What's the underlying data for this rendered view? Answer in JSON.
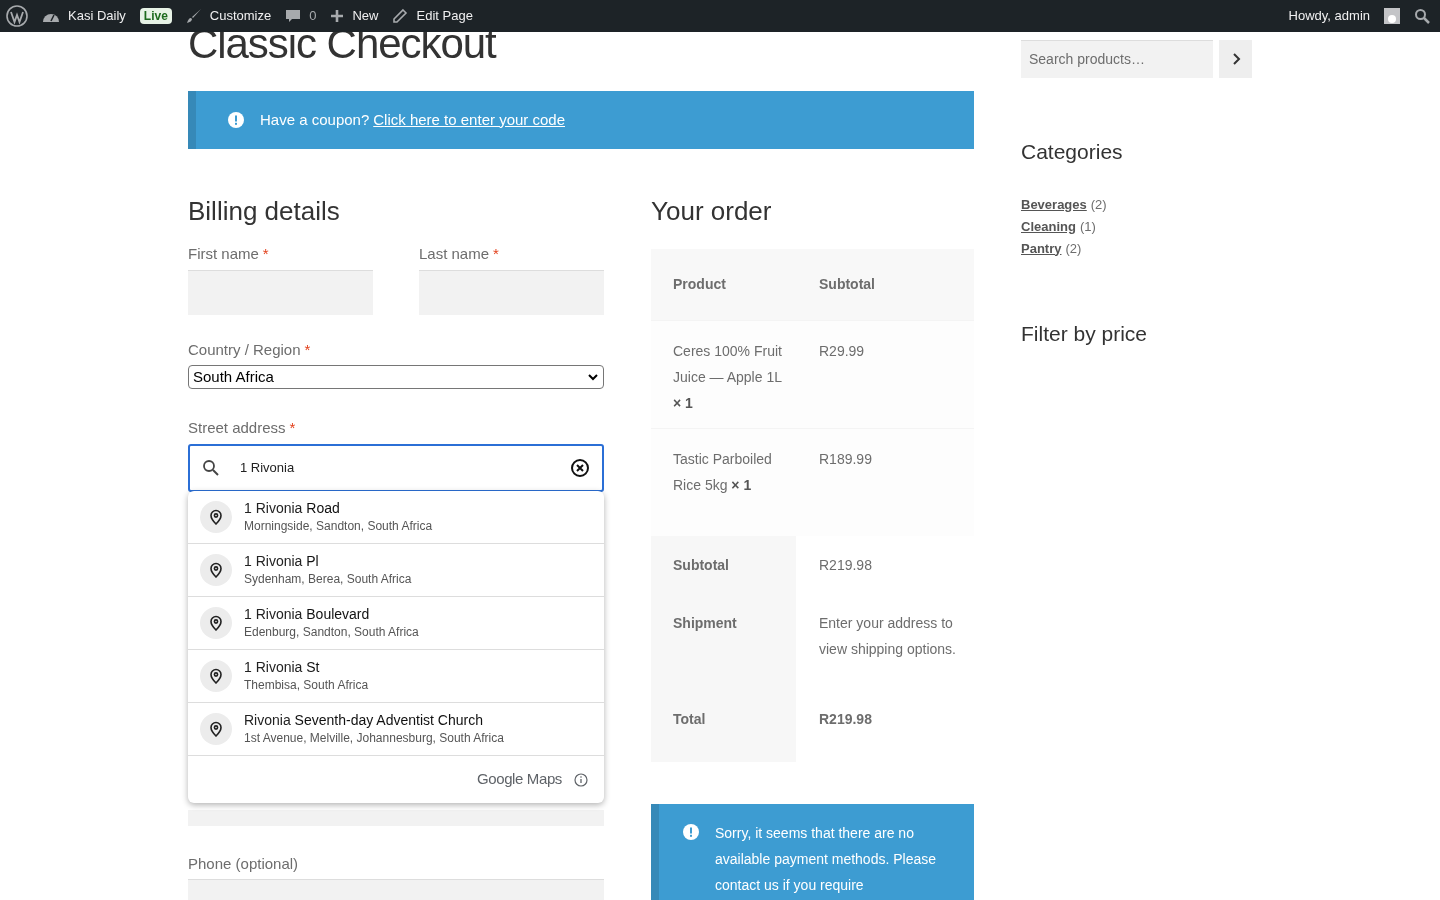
{
  "admin_bar": {
    "items": [
      {
        "kind": "wp"
      },
      {
        "kind": "site",
        "label": "Kasi Daily"
      },
      {
        "kind": "badge",
        "label": "Live"
      },
      {
        "kind": "brush",
        "label": "Customize"
      },
      {
        "kind": "comment",
        "label": "0"
      },
      {
        "kind": "plus",
        "label": "New"
      },
      {
        "kind": "pencil",
        "label": "Edit Page"
      }
    ],
    "greeting": "Howdy, admin"
  },
  "page_title": "Classic Checkout",
  "coupon_notice": {
    "text": "Have a coupon?",
    "link": "Click here to enter your code"
  },
  "billing": {
    "heading": "Billing details",
    "first_name": {
      "label": "First name",
      "required_mark": "*"
    },
    "last_name": {
      "label": "Last name",
      "required_mark": "*"
    },
    "country": {
      "label": "Country / Region",
      "required_mark": "*",
      "value": "South Africa"
    },
    "street": {
      "label": "Street address",
      "required_mark": "*",
      "value": "1 Rivonia"
    },
    "suggestions": [
      {
        "bold_match": "1 Rivonia",
        "rest": " Road",
        "sub": "Morningside, Sandton, South Africa"
      },
      {
        "bold_match": "1 Rivonia",
        "rest": " Pl",
        "sub": "Sydenham, Berea, South Africa"
      },
      {
        "bold_match": "1 Rivonia",
        "rest": " Boulevard",
        "sub": "Edenburg, Sandton, South Africa"
      },
      {
        "bold_match": "1 Rivonia",
        "rest": " St",
        "sub": "Thembisa, South Africa"
      },
      {
        "bold_match": "Rivonia",
        "rest": " Seventh-day Adventist Church",
        "sub": "1st Avenue, Melville, Johannesburg, South Africa"
      }
    ],
    "attribution": "Google Maps",
    "phone": {
      "label": "Phone (optional)"
    }
  },
  "order": {
    "heading": "Your order",
    "columns": [
      "Product",
      "Subtotal"
    ],
    "items": [
      {
        "name": "Ceres 100% Fruit Juice — Apple 1L",
        "qty": "× 1",
        "price": "R29.99"
      },
      {
        "name": "Tastic Parboiled Rice 5kg",
        "qty": "× 1",
        "price": "R189.99"
      }
    ],
    "totals": [
      {
        "label": "Subtotal",
        "value": "R219.98",
        "bold": false
      },
      {
        "label": "Shipment",
        "value": "Enter your address to view shipping options.",
        "bold": false
      },
      {
        "label": "Total",
        "value": "R219.98",
        "bold": true
      }
    ],
    "payment_notice": "Sorry, it seems that there are no available payment methods. Please contact us if you require"
  },
  "sidebar": {
    "search_placeholder": "Search products…",
    "categories_heading": "Categories",
    "categories": [
      {
        "name": "Beverages",
        "count": "(2)"
      },
      {
        "name": "Cleaning",
        "count": "(1)"
      },
      {
        "name": "Pantry",
        "count": "(2)"
      }
    ],
    "filter_heading": "Filter by price"
  }
}
